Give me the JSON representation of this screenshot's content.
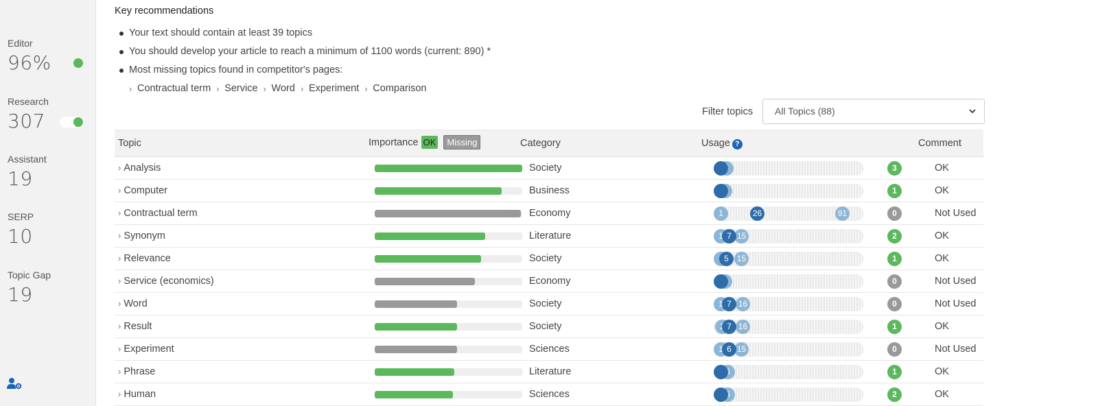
{
  "sidebar": {
    "stats": [
      {
        "label": "Editor",
        "value": "96%",
        "indicator": "dot"
      },
      {
        "label": "Research",
        "value": "307",
        "indicator": "toggle"
      },
      {
        "label": "Assistant",
        "value": "19",
        "indicator": "none"
      },
      {
        "label": "SERP",
        "value": "10",
        "indicator": "none"
      },
      {
        "label": "Topic Gap",
        "value": "19",
        "indicator": "none"
      }
    ],
    "bottom_icon": "user-settings-icon"
  },
  "recommendations": {
    "title": "Key recommendations",
    "items": [
      "Your text should contain at least 39 topics",
      "You should develop your article to reach a minimum of 1100 words (current: 890) *",
      "Most missing topics found in competitor's pages:"
    ],
    "missing_topics": [
      "Contractual term",
      "Service",
      "Word",
      "Experiment",
      "Comparison"
    ]
  },
  "filter": {
    "label": "Filter topics",
    "selected": "All Topics (88)"
  },
  "table": {
    "headers": {
      "topic": "Topic",
      "importance": "Importance",
      "ok_badge": "OK",
      "missing_badge": "Missing",
      "category": "Category",
      "usage": "Usage",
      "comment": "Comment"
    },
    "colors": {
      "ok": "#5cb85c",
      "missing": "#999999",
      "usage_light": "#8db6d6",
      "usage_dark": "#2d6ca8"
    },
    "rows": [
      {
        "topic": "Analysis",
        "importance": 1.0,
        "status": "ok",
        "category": "Society",
        "usage": [
          {
            "v": "",
            "pos": 0.0,
            "tone": "dark"
          },
          {
            "v": "5",
            "pos": 0.04,
            "tone": "light"
          }
        ],
        "count": "3",
        "comment": "OK"
      },
      {
        "topic": "Computer",
        "importance": 0.86,
        "status": "ok",
        "category": "Business",
        "usage": [
          {
            "v": "",
            "pos": 0.0,
            "tone": "dark"
          },
          {
            "v": "3",
            "pos": 0.03,
            "tone": "light"
          }
        ],
        "count": "1",
        "comment": "OK"
      },
      {
        "topic": "Contractual term",
        "importance": 0.99,
        "status": "missing",
        "category": "Economy",
        "usage": [
          {
            "v": "1",
            "pos": 0.0,
            "tone": "light"
          },
          {
            "v": "26",
            "pos": 0.27,
            "tone": "dark"
          },
          {
            "v": "91",
            "pos": 0.9,
            "tone": "light"
          }
        ],
        "count": "0",
        "comment": "Not Used"
      },
      {
        "topic": "Synonym",
        "importance": 0.75,
        "status": "ok",
        "category": "Literature",
        "usage": [
          {
            "v": "1",
            "pos": 0.0,
            "tone": "light"
          },
          {
            "v": "7",
            "pos": 0.06,
            "tone": "dark"
          },
          {
            "v": "15",
            "pos": 0.15,
            "tone": "light"
          }
        ],
        "count": "2",
        "comment": "OK"
      },
      {
        "topic": "Relevance",
        "importance": 0.72,
        "status": "ok",
        "category": "Society",
        "usage": [
          {
            "v": "",
            "pos": 0.0,
            "tone": "light"
          },
          {
            "v": "5",
            "pos": 0.04,
            "tone": "dark"
          },
          {
            "v": "15",
            "pos": 0.15,
            "tone": "light"
          }
        ],
        "count": "1",
        "comment": "OK"
      },
      {
        "topic": "Service (economics)",
        "importance": 0.68,
        "status": "missing",
        "category": "Economy",
        "usage": [
          {
            "v": "",
            "pos": 0.0,
            "tone": "dark"
          },
          {
            "v": "3",
            "pos": 0.03,
            "tone": "light"
          }
        ],
        "count": "0",
        "comment": "Not Used"
      },
      {
        "topic": "Word",
        "importance": 0.56,
        "status": "missing",
        "category": "Society",
        "usage": [
          {
            "v": "1",
            "pos": 0.0,
            "tone": "light"
          },
          {
            "v": "7",
            "pos": 0.06,
            "tone": "dark"
          },
          {
            "v": "16",
            "pos": 0.16,
            "tone": "light"
          }
        ],
        "count": "0",
        "comment": "Not Used"
      },
      {
        "topic": "Result",
        "importance": 0.56,
        "status": "ok",
        "category": "Society",
        "usage": [
          {
            "v": "2",
            "pos": 0.01,
            "tone": "light"
          },
          {
            "v": "7",
            "pos": 0.06,
            "tone": "dark"
          },
          {
            "v": "16",
            "pos": 0.16,
            "tone": "light"
          }
        ],
        "count": "1",
        "comment": "OK"
      },
      {
        "topic": "Experiment",
        "importance": 0.56,
        "status": "missing",
        "category": "Sciences",
        "usage": [
          {
            "v": "1",
            "pos": 0.0,
            "tone": "light"
          },
          {
            "v": "6",
            "pos": 0.06,
            "tone": "dark"
          },
          {
            "v": "15",
            "pos": 0.15,
            "tone": "light"
          }
        ],
        "count": "0",
        "comment": "Not Used"
      },
      {
        "topic": "Phrase",
        "importance": 0.54,
        "status": "ok",
        "category": "Literature",
        "usage": [
          {
            "v": "",
            "pos": 0.0,
            "tone": "dark"
          },
          {
            "v": "6",
            "pos": 0.05,
            "tone": "light"
          }
        ],
        "count": "1",
        "comment": "OK"
      },
      {
        "topic": "Human",
        "importance": 0.53,
        "status": "ok",
        "category": "Sciences",
        "usage": [
          {
            "v": "",
            "pos": 0.0,
            "tone": "dark"
          },
          {
            "v": "6",
            "pos": 0.05,
            "tone": "light"
          }
        ],
        "count": "2",
        "comment": "OK"
      }
    ]
  }
}
